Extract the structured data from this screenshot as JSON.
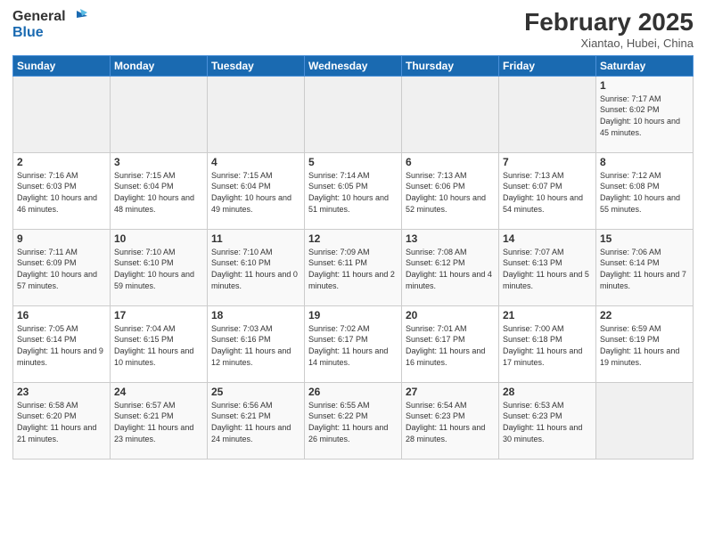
{
  "logo": {
    "line1": "General",
    "line2": "Blue"
  },
  "title": "February 2025",
  "subtitle": "Xiantao, Hubei, China",
  "weekdays": [
    "Sunday",
    "Monday",
    "Tuesday",
    "Wednesday",
    "Thursday",
    "Friday",
    "Saturday"
  ],
  "weeks": [
    [
      {
        "day": "",
        "info": ""
      },
      {
        "day": "",
        "info": ""
      },
      {
        "day": "",
        "info": ""
      },
      {
        "day": "",
        "info": ""
      },
      {
        "day": "",
        "info": ""
      },
      {
        "day": "",
        "info": ""
      },
      {
        "day": "1",
        "info": "Sunrise: 7:17 AM\nSunset: 6:02 PM\nDaylight: 10 hours and 45 minutes."
      }
    ],
    [
      {
        "day": "2",
        "info": "Sunrise: 7:16 AM\nSunset: 6:03 PM\nDaylight: 10 hours and 46 minutes."
      },
      {
        "day": "3",
        "info": "Sunrise: 7:15 AM\nSunset: 6:04 PM\nDaylight: 10 hours and 48 minutes."
      },
      {
        "day": "4",
        "info": "Sunrise: 7:15 AM\nSunset: 6:04 PM\nDaylight: 10 hours and 49 minutes."
      },
      {
        "day": "5",
        "info": "Sunrise: 7:14 AM\nSunset: 6:05 PM\nDaylight: 10 hours and 51 minutes."
      },
      {
        "day": "6",
        "info": "Sunrise: 7:13 AM\nSunset: 6:06 PM\nDaylight: 10 hours and 52 minutes."
      },
      {
        "day": "7",
        "info": "Sunrise: 7:13 AM\nSunset: 6:07 PM\nDaylight: 10 hours and 54 minutes."
      },
      {
        "day": "8",
        "info": "Sunrise: 7:12 AM\nSunset: 6:08 PM\nDaylight: 10 hours and 55 minutes."
      }
    ],
    [
      {
        "day": "9",
        "info": "Sunrise: 7:11 AM\nSunset: 6:09 PM\nDaylight: 10 hours and 57 minutes."
      },
      {
        "day": "10",
        "info": "Sunrise: 7:10 AM\nSunset: 6:10 PM\nDaylight: 10 hours and 59 minutes."
      },
      {
        "day": "11",
        "info": "Sunrise: 7:10 AM\nSunset: 6:10 PM\nDaylight: 11 hours and 0 minutes."
      },
      {
        "day": "12",
        "info": "Sunrise: 7:09 AM\nSunset: 6:11 PM\nDaylight: 11 hours and 2 minutes."
      },
      {
        "day": "13",
        "info": "Sunrise: 7:08 AM\nSunset: 6:12 PM\nDaylight: 11 hours and 4 minutes."
      },
      {
        "day": "14",
        "info": "Sunrise: 7:07 AM\nSunset: 6:13 PM\nDaylight: 11 hours and 5 minutes."
      },
      {
        "day": "15",
        "info": "Sunrise: 7:06 AM\nSunset: 6:14 PM\nDaylight: 11 hours and 7 minutes."
      }
    ],
    [
      {
        "day": "16",
        "info": "Sunrise: 7:05 AM\nSunset: 6:14 PM\nDaylight: 11 hours and 9 minutes."
      },
      {
        "day": "17",
        "info": "Sunrise: 7:04 AM\nSunset: 6:15 PM\nDaylight: 11 hours and 10 minutes."
      },
      {
        "day": "18",
        "info": "Sunrise: 7:03 AM\nSunset: 6:16 PM\nDaylight: 11 hours and 12 minutes."
      },
      {
        "day": "19",
        "info": "Sunrise: 7:02 AM\nSunset: 6:17 PM\nDaylight: 11 hours and 14 minutes."
      },
      {
        "day": "20",
        "info": "Sunrise: 7:01 AM\nSunset: 6:17 PM\nDaylight: 11 hours and 16 minutes."
      },
      {
        "day": "21",
        "info": "Sunrise: 7:00 AM\nSunset: 6:18 PM\nDaylight: 11 hours and 17 minutes."
      },
      {
        "day": "22",
        "info": "Sunrise: 6:59 AM\nSunset: 6:19 PM\nDaylight: 11 hours and 19 minutes."
      }
    ],
    [
      {
        "day": "23",
        "info": "Sunrise: 6:58 AM\nSunset: 6:20 PM\nDaylight: 11 hours and 21 minutes."
      },
      {
        "day": "24",
        "info": "Sunrise: 6:57 AM\nSunset: 6:21 PM\nDaylight: 11 hours and 23 minutes."
      },
      {
        "day": "25",
        "info": "Sunrise: 6:56 AM\nSunset: 6:21 PM\nDaylight: 11 hours and 24 minutes."
      },
      {
        "day": "26",
        "info": "Sunrise: 6:55 AM\nSunset: 6:22 PM\nDaylight: 11 hours and 26 minutes."
      },
      {
        "day": "27",
        "info": "Sunrise: 6:54 AM\nSunset: 6:23 PM\nDaylight: 11 hours and 28 minutes."
      },
      {
        "day": "28",
        "info": "Sunrise: 6:53 AM\nSunset: 6:23 PM\nDaylight: 11 hours and 30 minutes."
      },
      {
        "day": "",
        "info": ""
      }
    ]
  ]
}
